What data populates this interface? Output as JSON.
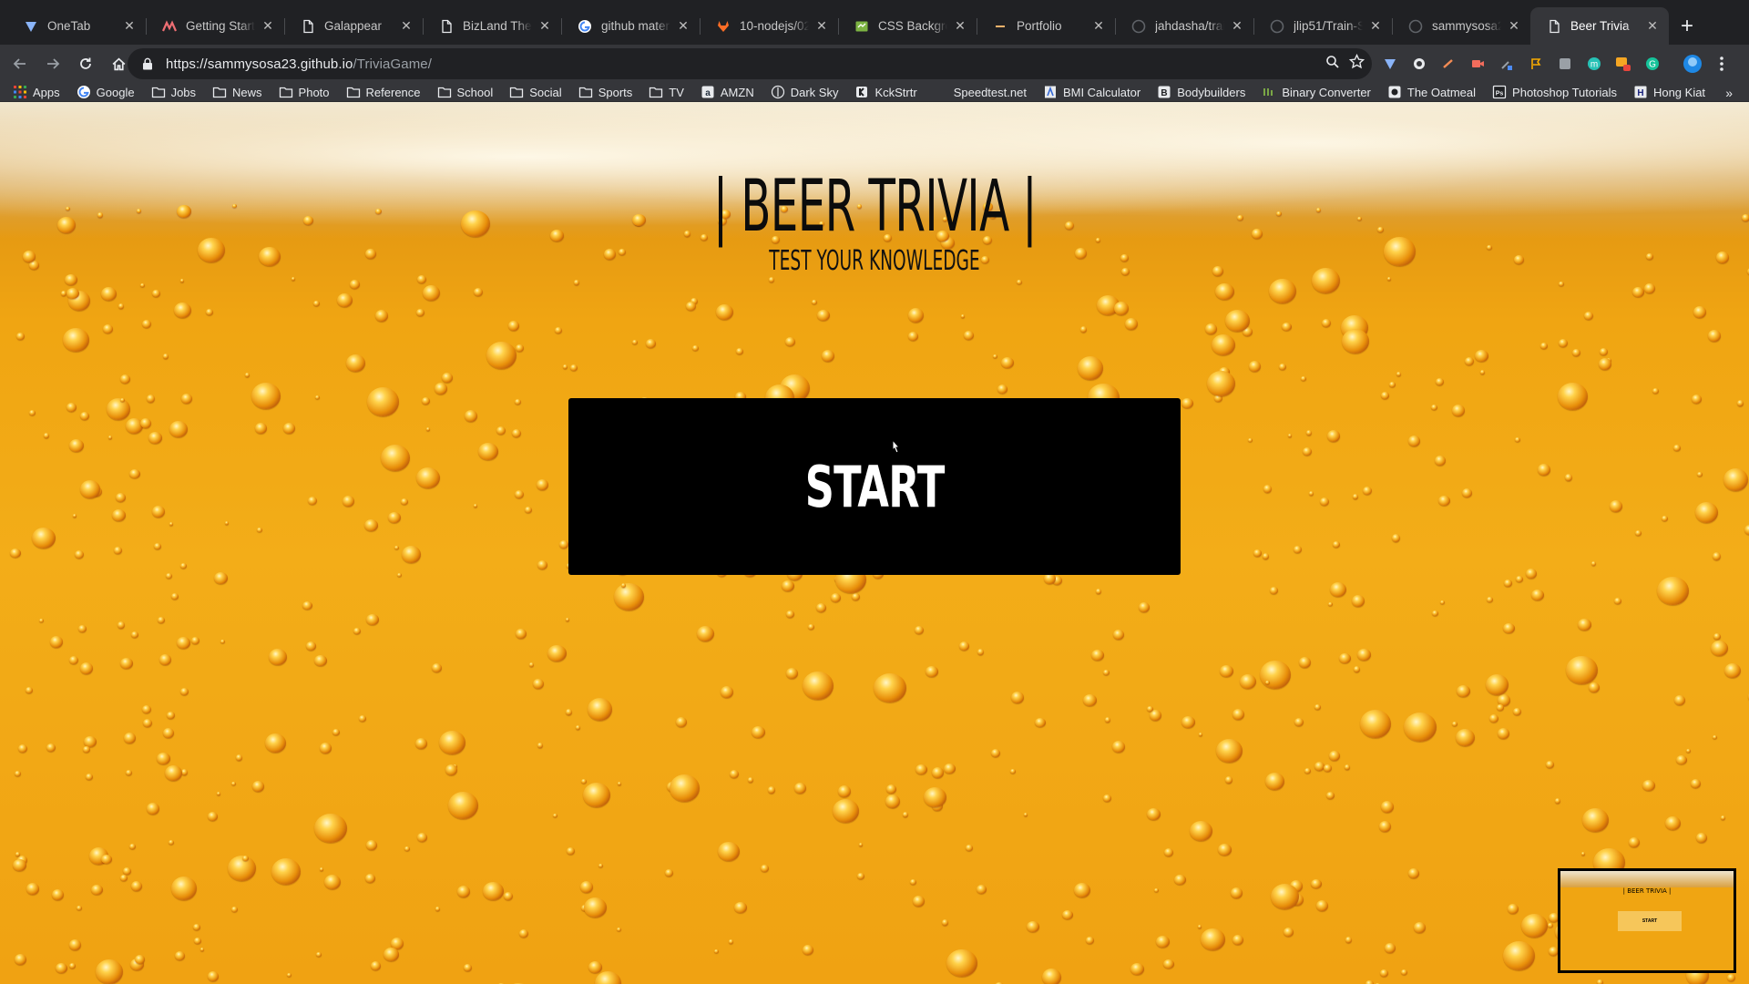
{
  "browser": {
    "tabs": [
      {
        "title": "OneTab",
        "icon": "onetab-icon",
        "active": false
      },
      {
        "title": "Getting Started",
        "icon": "materialize-icon",
        "active": false
      },
      {
        "title": "Galappear",
        "icon": "page-icon",
        "active": false
      },
      {
        "title": "BizLand Theme",
        "icon": "page-icon",
        "active": false
      },
      {
        "title": "github materialize",
        "icon": "google-icon",
        "active": false
      },
      {
        "title": "10-nodejs/02-H",
        "icon": "gitlab-icon",
        "active": false
      },
      {
        "title": "CSS Background",
        "icon": "css-icon",
        "active": false
      },
      {
        "title": "Portfolio",
        "icon": "dash-icon",
        "active": false
      },
      {
        "title": "jahdasha/train-",
        "icon": "github-icon",
        "active": false
      },
      {
        "title": "jlip51/Train-Sch",
        "icon": "github-icon",
        "active": false
      },
      {
        "title": "sammysosa23/",
        "icon": "github-icon",
        "active": false
      },
      {
        "title": "Beer Trivia",
        "icon": "page-icon",
        "active": true
      }
    ],
    "url": {
      "host": "https://sammysosa23.github.io",
      "path": "/TriviaGame/"
    },
    "bookmarks": [
      {
        "label": "Apps",
        "icon": "apps-grid-icon"
      },
      {
        "label": "Google",
        "icon": "google-icon"
      },
      {
        "label": "Jobs",
        "icon": "folder-icon"
      },
      {
        "label": "News",
        "icon": "folder-icon"
      },
      {
        "label": "Photo",
        "icon": "folder-icon"
      },
      {
        "label": "Reference",
        "icon": "folder-icon"
      },
      {
        "label": "School",
        "icon": "folder-icon"
      },
      {
        "label": "Social",
        "icon": "folder-icon"
      },
      {
        "label": "Sports",
        "icon": "folder-icon"
      },
      {
        "label": "TV",
        "icon": "folder-icon"
      },
      {
        "label": "AMZN",
        "icon": "amzn-icon"
      },
      {
        "label": "Dark Sky",
        "icon": "darksky-icon"
      },
      {
        "label": "KckStrtr",
        "icon": "kickstarter-icon"
      },
      {
        "label": "Speedtest.net",
        "icon": "blank-icon"
      },
      {
        "label": "BMI Calculator",
        "icon": "bmi-icon"
      },
      {
        "label": "Bodybuilders",
        "icon": "bodybuilding-icon"
      },
      {
        "label": "Binary Converter",
        "icon": "binary-icon"
      },
      {
        "label": "The Oatmeal",
        "icon": "oatmeal-icon"
      },
      {
        "label": "Photoshop Tutorials",
        "icon": "photoshop-icon"
      },
      {
        "label": "Hong Kiat",
        "icon": "hongkiat-icon"
      }
    ],
    "bookmarks_overflow": "»"
  },
  "page": {
    "title": "| BEER TRIVIA |",
    "subtitle": "TEST YOUR KNOWLEDGE",
    "start_label": "START",
    "thumbnail": {
      "title": "| BEER TRIVIA |",
      "start_label": "START"
    }
  }
}
